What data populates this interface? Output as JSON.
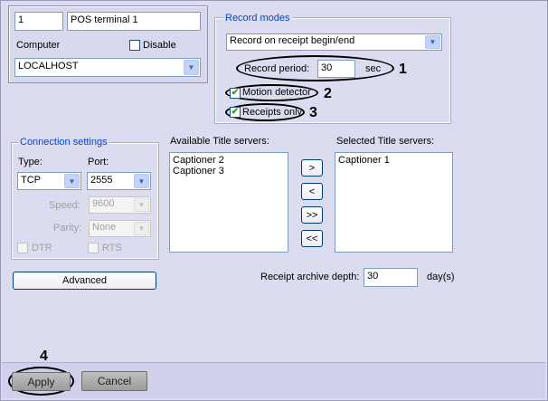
{
  "terminal": {
    "number": "1",
    "name": "POS terminal 1"
  },
  "computer": {
    "label": "Computer",
    "disable_label": "Disable",
    "value": "LOCALHOST"
  },
  "record_modes": {
    "legend": "Record modes",
    "mode": "Record on receipt begin/end",
    "period_label": "Record period:",
    "period_value": "30",
    "period_unit": "sec",
    "motion_detector": "Motion detector",
    "receipts_only": "Receipts only"
  },
  "connection": {
    "legend": "Connection settings",
    "type_label": "Type:",
    "type_value": "TCP",
    "port_label": "Port:",
    "port_value": "2555",
    "speed_label": "Speed:",
    "speed_value": "9600",
    "parity_label": "Parity:",
    "parity_value": "None",
    "dtr": "DTR",
    "rts": "RTS"
  },
  "advanced_label": "Advanced",
  "available": {
    "label": "Available Title servers:",
    "items": [
      "Captioner 2",
      "Captioner 3"
    ]
  },
  "selected": {
    "label": "Selected Title servers:",
    "items": [
      "Captioner 1"
    ]
  },
  "transfer": {
    "add": ">",
    "remove": "<",
    "add_all": ">>",
    "remove_all": "<<"
  },
  "archive": {
    "label": "Receipt archive depth:",
    "value": "30",
    "unit": "day(s)"
  },
  "annotations": {
    "n1": "1",
    "n2": "2",
    "n3": "3",
    "n4": "4"
  },
  "footer": {
    "apply": "Apply",
    "cancel": "Cancel"
  }
}
